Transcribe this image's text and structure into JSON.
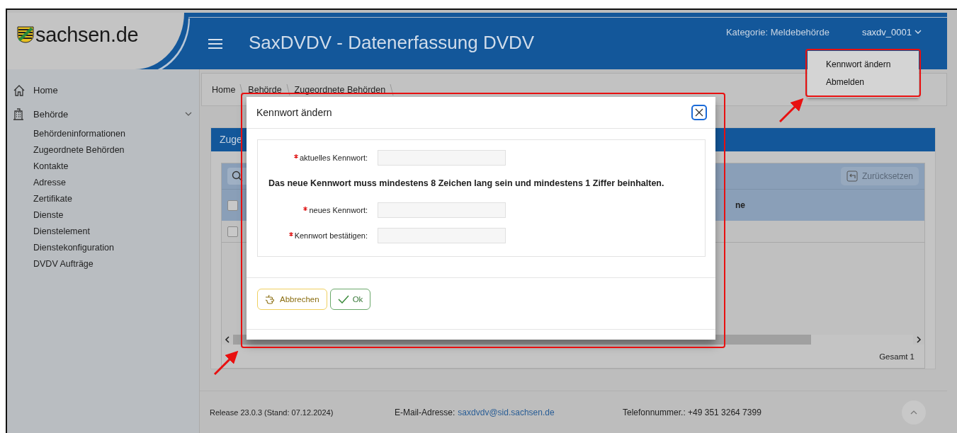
{
  "header": {
    "logo_text": "sachsen.de",
    "title": "SaxDVDV - Datenerfassung DVDV",
    "category": "Kategorie: Meldebehörde",
    "user": "saxdv_0001"
  },
  "user_menu": {
    "items": [
      {
        "label": "Kennwort ändern"
      },
      {
        "label": "Abmelden"
      }
    ]
  },
  "sidebar": {
    "items": [
      {
        "label": "Home"
      },
      {
        "label": "Behörde",
        "expanded": true,
        "children": [
          {
            "label": "Behördeninformationen"
          },
          {
            "label": "Zugeordnete Behörden"
          },
          {
            "label": "Kontakte"
          },
          {
            "label": "Adresse"
          },
          {
            "label": "Zertifikate"
          },
          {
            "label": "Dienste"
          },
          {
            "label": "Dienstelement"
          },
          {
            "label": "Dienstekonfiguration"
          },
          {
            "label": "DVDV Aufträge"
          }
        ]
      }
    ]
  },
  "breadcrumb": [
    "Home",
    "Behörde",
    "Zugeordnete Behörden"
  ],
  "panel": {
    "title": "Zuge",
    "reset_button": "Zurücksetzen",
    "table": {
      "column_3": "ne",
      "header_checked": false,
      "rows": [
        {
          "checked": false
        }
      ]
    },
    "total": "Gesamt 1"
  },
  "dialog": {
    "title": "Kennwort ändern",
    "items": [
      {
        "kind": "field",
        "label": "aktuelles Kennwort:",
        "required": true
      },
      {
        "kind": "note",
        "text": "Das neue Kennwort muss mindestens 8 Zeichen lang sein und mindestens 1 Ziffer beinhalten."
      },
      {
        "kind": "field",
        "label": "neues Kennwort:",
        "required": true
      },
      {
        "kind": "field",
        "label": "Kennwort bestätigen:",
        "required": true
      }
    ],
    "buttons": [
      {
        "kind": "cancel",
        "label": "Abbrechen"
      },
      {
        "kind": "ok",
        "label": "Ok"
      }
    ]
  },
  "footer": {
    "release": "Release 23.0.3 (Stand: 07.12.2024)",
    "email_label": "E-Mail-Adresse:",
    "email": "saxdvdv@sid.sachsen.de",
    "phone": "Telefonnummer.: +49 351 3264 7399"
  }
}
